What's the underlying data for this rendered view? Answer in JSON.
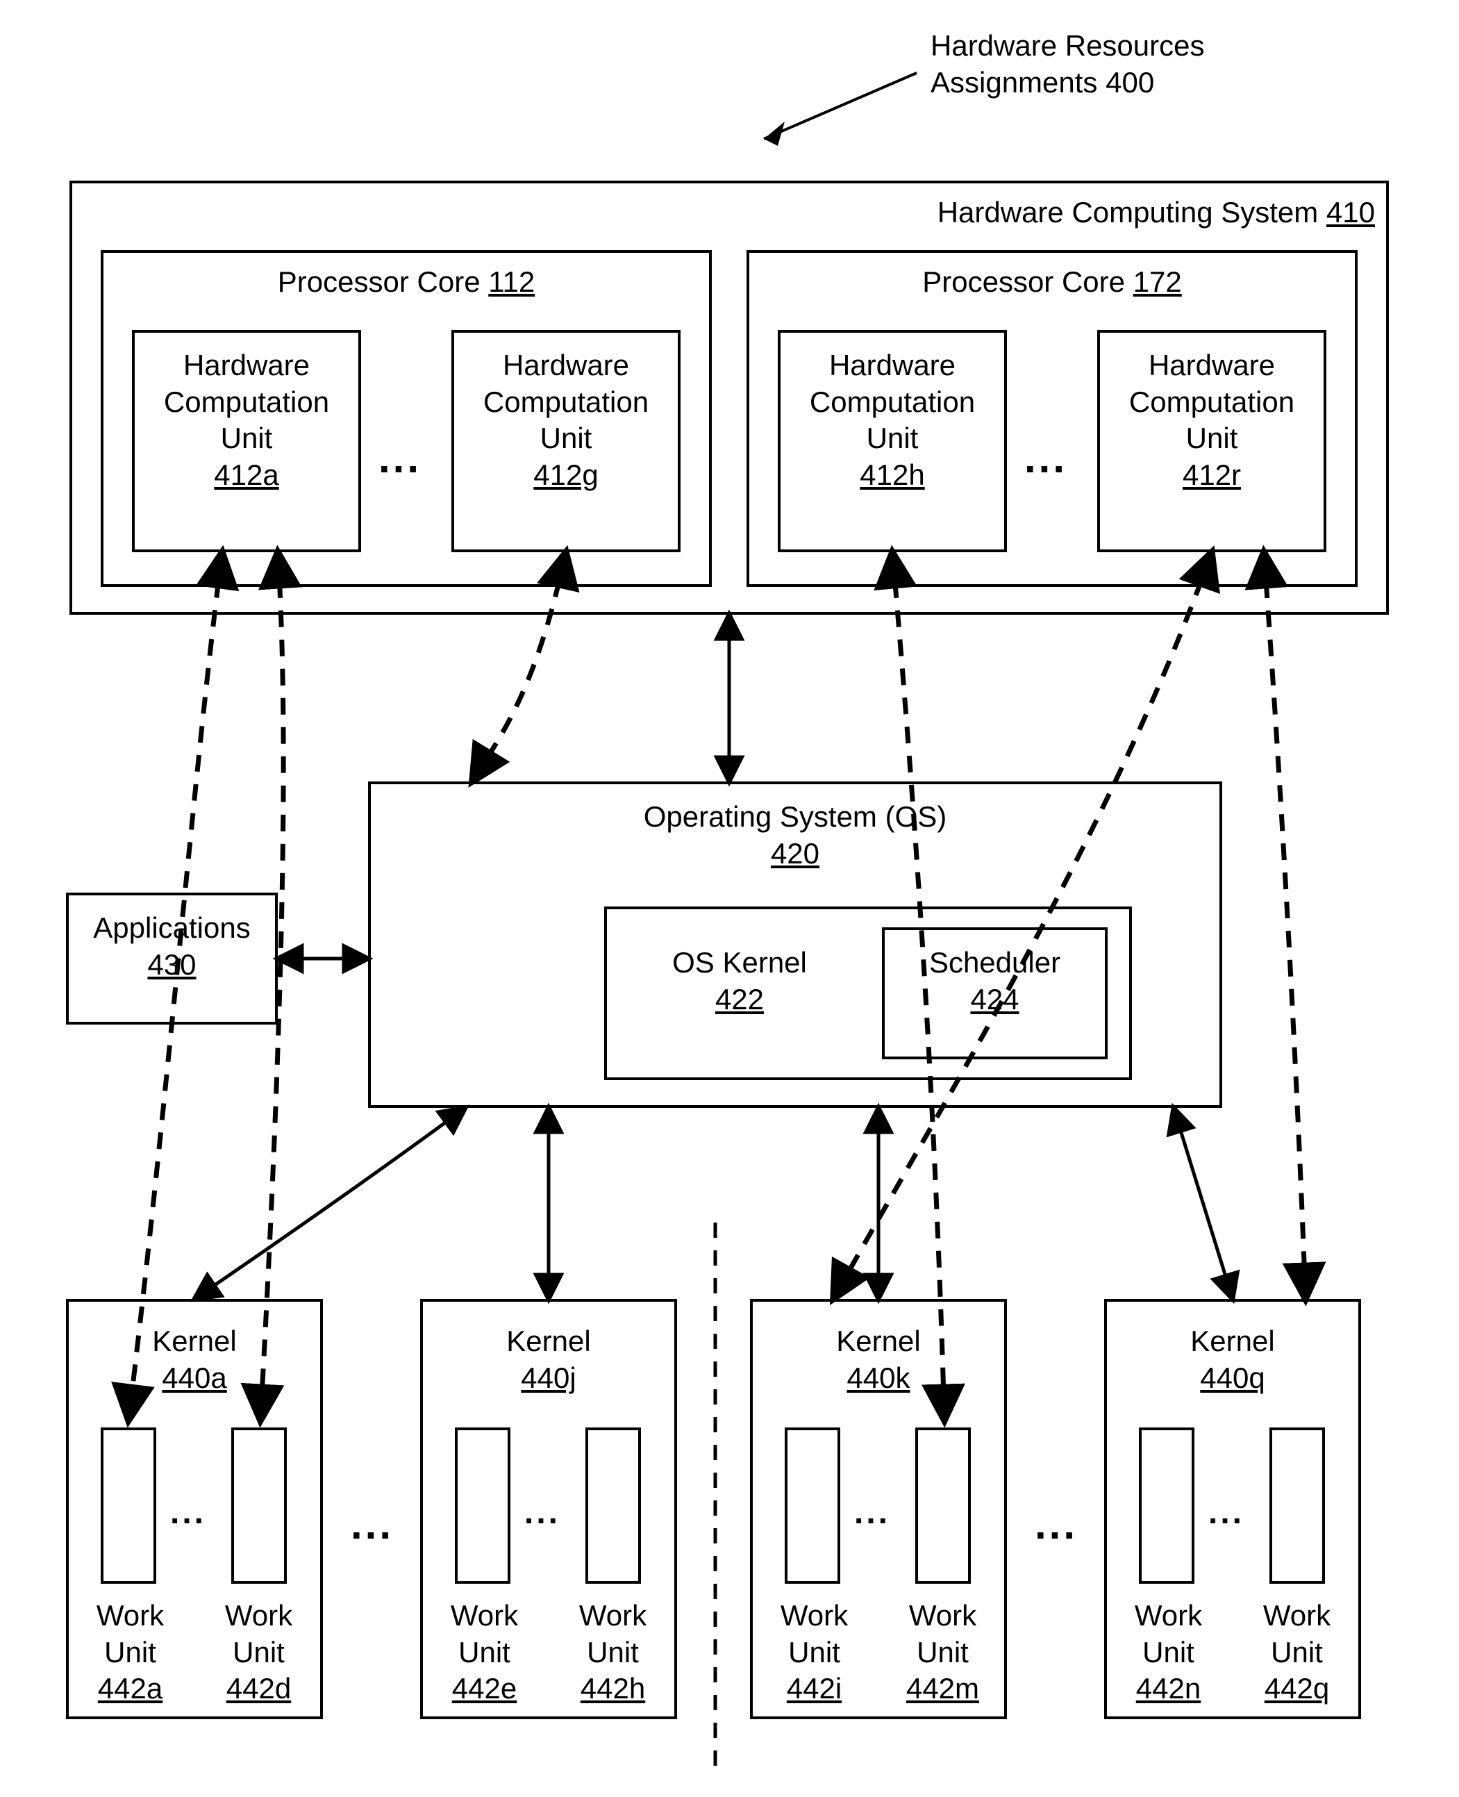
{
  "title": {
    "line1": "Hardware Resources",
    "line2": "Assignments 400"
  },
  "system": {
    "title": "Hardware Computing System",
    "ref": "410"
  },
  "core1": {
    "title": "Processor Core",
    "ref": "112"
  },
  "core2": {
    "title": "Processor Core",
    "ref": "172"
  },
  "hcu_a": {
    "l1": "Hardware",
    "l2": "Computation",
    "l3": "Unit",
    "ref": "412a"
  },
  "hcu_g": {
    "l1": "Hardware",
    "l2": "Computation",
    "l3": "Unit",
    "ref": "412g"
  },
  "hcu_h": {
    "l1": "Hardware",
    "l2": "Computation",
    "l3": "Unit",
    "ref": "412h"
  },
  "hcu_r": {
    "l1": "Hardware",
    "l2": "Computation",
    "l3": "Unit",
    "ref": "412r"
  },
  "os": {
    "title": "Operating System (OS)",
    "ref": "420"
  },
  "osk": {
    "title": "OS Kernel",
    "ref": "422"
  },
  "sched": {
    "title": "Scheduler",
    "ref": "424"
  },
  "apps": {
    "title": "Applications",
    "ref": "430"
  },
  "k_a": {
    "title": "Kernel",
    "ref": "440a"
  },
  "k_j": {
    "title": "Kernel",
    "ref": "440j"
  },
  "k_k": {
    "title": "Kernel",
    "ref": "440k"
  },
  "k_q": {
    "title": "Kernel",
    "ref": "440q"
  },
  "wu_a": {
    "l1": "Work",
    "l2": "Unit",
    "ref": "442a"
  },
  "wu_d": {
    "l1": "Work",
    "l2": "Unit",
    "ref": "442d"
  },
  "wu_e": {
    "l1": "Work",
    "l2": "Unit",
    "ref": "442e"
  },
  "wu_h": {
    "l1": "Work",
    "l2": "Unit",
    "ref": "442h"
  },
  "wu_i": {
    "l1": "Work",
    "l2": "Unit",
    "ref": "442i"
  },
  "wu_m": {
    "l1": "Work",
    "l2": "Unit",
    "ref": "442m"
  },
  "wu_n": {
    "l1": "Work",
    "l2": "Unit",
    "ref": "442n"
  },
  "wu_q": {
    "l1": "Work",
    "l2": "Unit",
    "ref": "442q"
  },
  "ellipsis": "..."
}
